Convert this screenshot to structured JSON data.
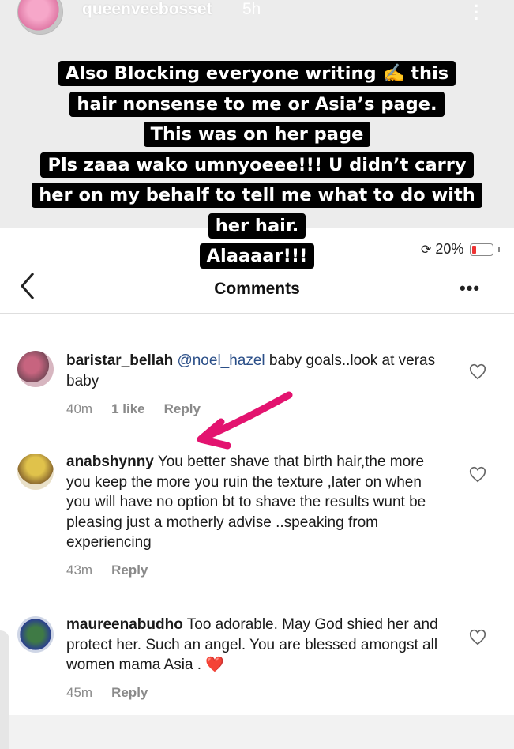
{
  "story": {
    "username": "queenveebosset",
    "time": "5h",
    "menu_icon": "vertical-dots-icon"
  },
  "caption": {
    "lines": [
      "Also Blocking everyone writing ✍️ this",
      "hair nonsense to me or Asia’s page.",
      "This was on her page",
      "Pls zaaa wako umnyoeee!!! U didn’t carry",
      "her on my behalf to tell me what to do with",
      "her hair.",
      "Alaaaar!!!"
    ]
  },
  "status": {
    "battery": "20%",
    "battery_level": 0.2
  },
  "header": {
    "title": "Comments",
    "back_icon": "chevron-left-icon",
    "more_icon": "more-horizontal-icon"
  },
  "comments": [
    {
      "username": "baristar_bellah",
      "mention": "@noel_hazel",
      "text": " baby goals..look at veras baby",
      "time": "40m",
      "likes": "1 like",
      "reply": "Reply"
    },
    {
      "username": "anabshynny",
      "mention": "",
      "text": "You better shave that birth hair,the more you keep the more you ruin the texture ,later on when you will have no option bt to  shave the results wunt be pleasing just a motherly advise ..speaking from experiencing",
      "time": "43m",
      "likes": "",
      "reply": "Reply"
    },
    {
      "username": "maureenabudho",
      "mention": "",
      "text": "Too adorable. May God shied her and protect her. Such an angel. You are blessed amongst all women mama Asia . ❤️",
      "time": "45m",
      "likes": "",
      "reply": "Reply"
    }
  ],
  "colors": {
    "annotation_arrow": "#e3136f",
    "mention": "#2b4f88"
  }
}
